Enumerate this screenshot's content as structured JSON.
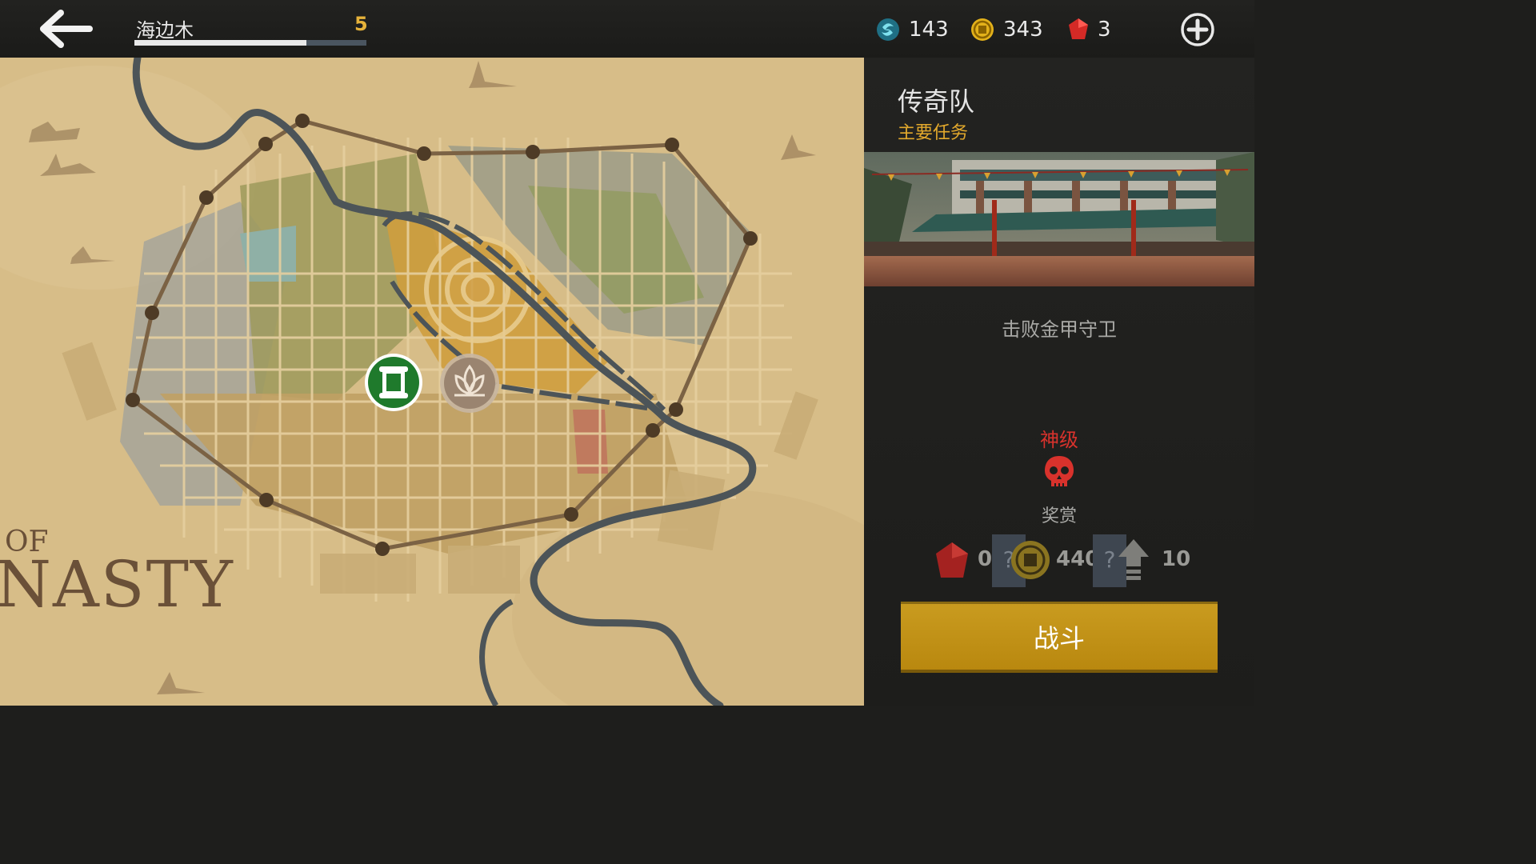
{
  "topbar": {
    "location_name": "海边木",
    "location_level": "5",
    "xp_progress": 0.74,
    "currencies": [
      {
        "icon": "energy-orb-icon",
        "value": "143",
        "color": "#2aa3b8"
      },
      {
        "icon": "coin-icon",
        "value": "343",
        "color": "#e3b11a"
      },
      {
        "icon": "ruby-gem-icon",
        "value": "3",
        "color": "#d42a26"
      }
    ],
    "add_button_icon": "plus-circle-icon",
    "back_button_icon": "arrow-left-icon"
  },
  "map": {
    "title_line1": "OF",
    "title_line2": "NASTY",
    "markers": [
      {
        "icon": "scroll-quest-icon",
        "state": "active",
        "color": "#1f7a2c"
      },
      {
        "icon": "lotus-icon",
        "state": "locked",
        "color": "#9a8470"
      }
    ]
  },
  "panel": {
    "mission_title": "传奇队",
    "mission_type": "主要任务",
    "objective": "击败金甲守卫",
    "difficulty_label": "神级",
    "difficulty_icon": "skull-icon",
    "rewards_label": "奖赏",
    "rewards": [
      {
        "icon": "ruby-gem-icon",
        "value": "0",
        "hidden_marker": "?"
      },
      {
        "icon": "coin-icon",
        "value": "440",
        "hidden_marker": "?"
      },
      {
        "icon": "experience-arrow-icon",
        "value": "10"
      }
    ],
    "fight_button_label": "战斗"
  },
  "colors": {
    "accent_gold": "#e3a92c",
    "danger_red": "#d8322c",
    "button_gold": "#c99b1f",
    "map_parchment": "#d9bf8a"
  }
}
